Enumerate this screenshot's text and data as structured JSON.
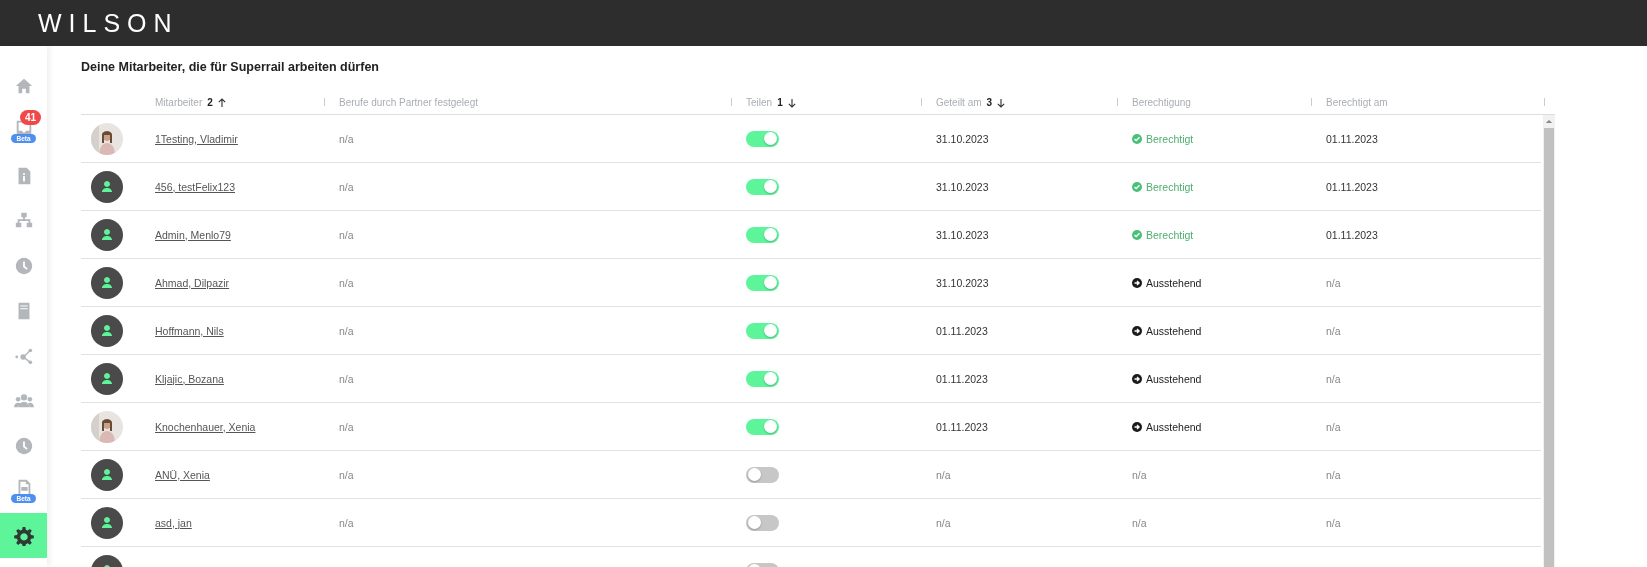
{
  "header": {
    "logo": "WILSON"
  },
  "sidebar": {
    "items": [
      {
        "kind": "home",
        "selected": false
      },
      {
        "kind": "inbox",
        "selected": false,
        "badge": "41",
        "tag": "Beta"
      },
      {
        "kind": "info",
        "selected": false
      },
      {
        "kind": "sitemap",
        "selected": false
      },
      {
        "kind": "clock",
        "selected": false
      },
      {
        "kind": "book",
        "selected": false
      },
      {
        "kind": "network",
        "selected": false
      },
      {
        "kind": "users",
        "selected": false
      },
      {
        "kind": "clock",
        "selected": false
      },
      {
        "kind": "document",
        "selected": false,
        "tag": "Beta"
      },
      {
        "kind": "settings",
        "selected": true
      }
    ]
  },
  "title": "Deine Mitarbeiter, die für Superrail arbeiten dürfen",
  "table": {
    "columns": [
      {
        "label": "Mitarbeiter",
        "sort": {
          "order": "2",
          "ascending": true
        }
      },
      {
        "label": "Berufe durch Partner festgelegt"
      },
      {
        "label": "Teilen",
        "sort": {
          "order": "1",
          "ascending": false
        }
      },
      {
        "label": "Geteilt am",
        "sort": {
          "order": "3",
          "ascending": false
        }
      },
      {
        "label": "Berechtigung"
      },
      {
        "label": "Berechtigt am"
      }
    ],
    "rows": [
      {
        "name": "1Testing, Vladimir",
        "professions": "n/a",
        "shared": true,
        "shared_on": "31.10.2023",
        "permission": {
          "label": "Berechtigt",
          "kind": "granted"
        },
        "permitted_on": "01.11.2023"
      },
      {
        "avatar": {
          "kind": "placeholder"
        },
        "name": "456, testFelix123",
        "professions": "n/a",
        "shared": true,
        "shared_on": "31.10.2023",
        "permission": {
          "label": "Berechtigt",
          "kind": "granted"
        },
        "permitted_on": "01.11.2023"
      },
      {
        "avatar": {
          "kind": "placeholder"
        },
        "name": "Admin, Menlo79",
        "professions": "n/a",
        "shared": true,
        "shared_on": "31.10.2023",
        "permission": {
          "label": "Berechtigt",
          "kind": "granted"
        },
        "permitted_on": "01.11.2023"
      },
      {
        "avatar": {
          "kind": "placeholder"
        },
        "name": "Ahmad, Dilpazir",
        "professions": "n/a",
        "shared": true,
        "shared_on": "31.10.2023",
        "permission": {
          "label": "Ausstehend",
          "kind": "pending"
        },
        "permitted_on": "n/a"
      },
      {
        "avatar": {
          "kind": "placeholder"
        },
        "name": "Hoffmann, Nils",
        "professions": "n/a",
        "shared": true,
        "shared_on": "01.11.2023",
        "permission": {
          "label": "Ausstehend",
          "kind": "pending"
        },
        "permitted_on": "n/a"
      },
      {
        "avatar": {
          "kind": "placeholder"
        },
        "name": "Kljajic, Bozana",
        "professions": "n/a",
        "shared": true,
        "shared_on": "01.11.2023",
        "permission": {
          "label": "Ausstehend",
          "kind": "pending"
        },
        "permitted_on": "n/a"
      },
      {
        "name": "Knochenhauer, Xenia",
        "professions": "n/a",
        "shared": true,
        "shared_on": "01.11.2023",
        "permission": {
          "label": "Ausstehend",
          "kind": "pending"
        },
        "permitted_on": "n/a"
      },
      {
        "avatar": {
          "kind": "placeholder"
        },
        "name": "ANÜ, Xenia",
        "professions": "n/a",
        "shared": false,
        "shared_on": "n/a",
        "permission": {
          "label": "n/a",
          "kind": "none"
        },
        "permitted_on": "n/a"
      },
      {
        "avatar": {
          "kind": "placeholder"
        },
        "name": "asd, jan",
        "professions": "n/a",
        "shared": false,
        "shared_on": "n/a",
        "permission": {
          "label": "n/a",
          "kind": "none"
        },
        "permitted_on": "n/a"
      },
      {
        "avatar": {
          "kind": "placeholder"
        },
        "shared": false
      }
    ]
  }
}
